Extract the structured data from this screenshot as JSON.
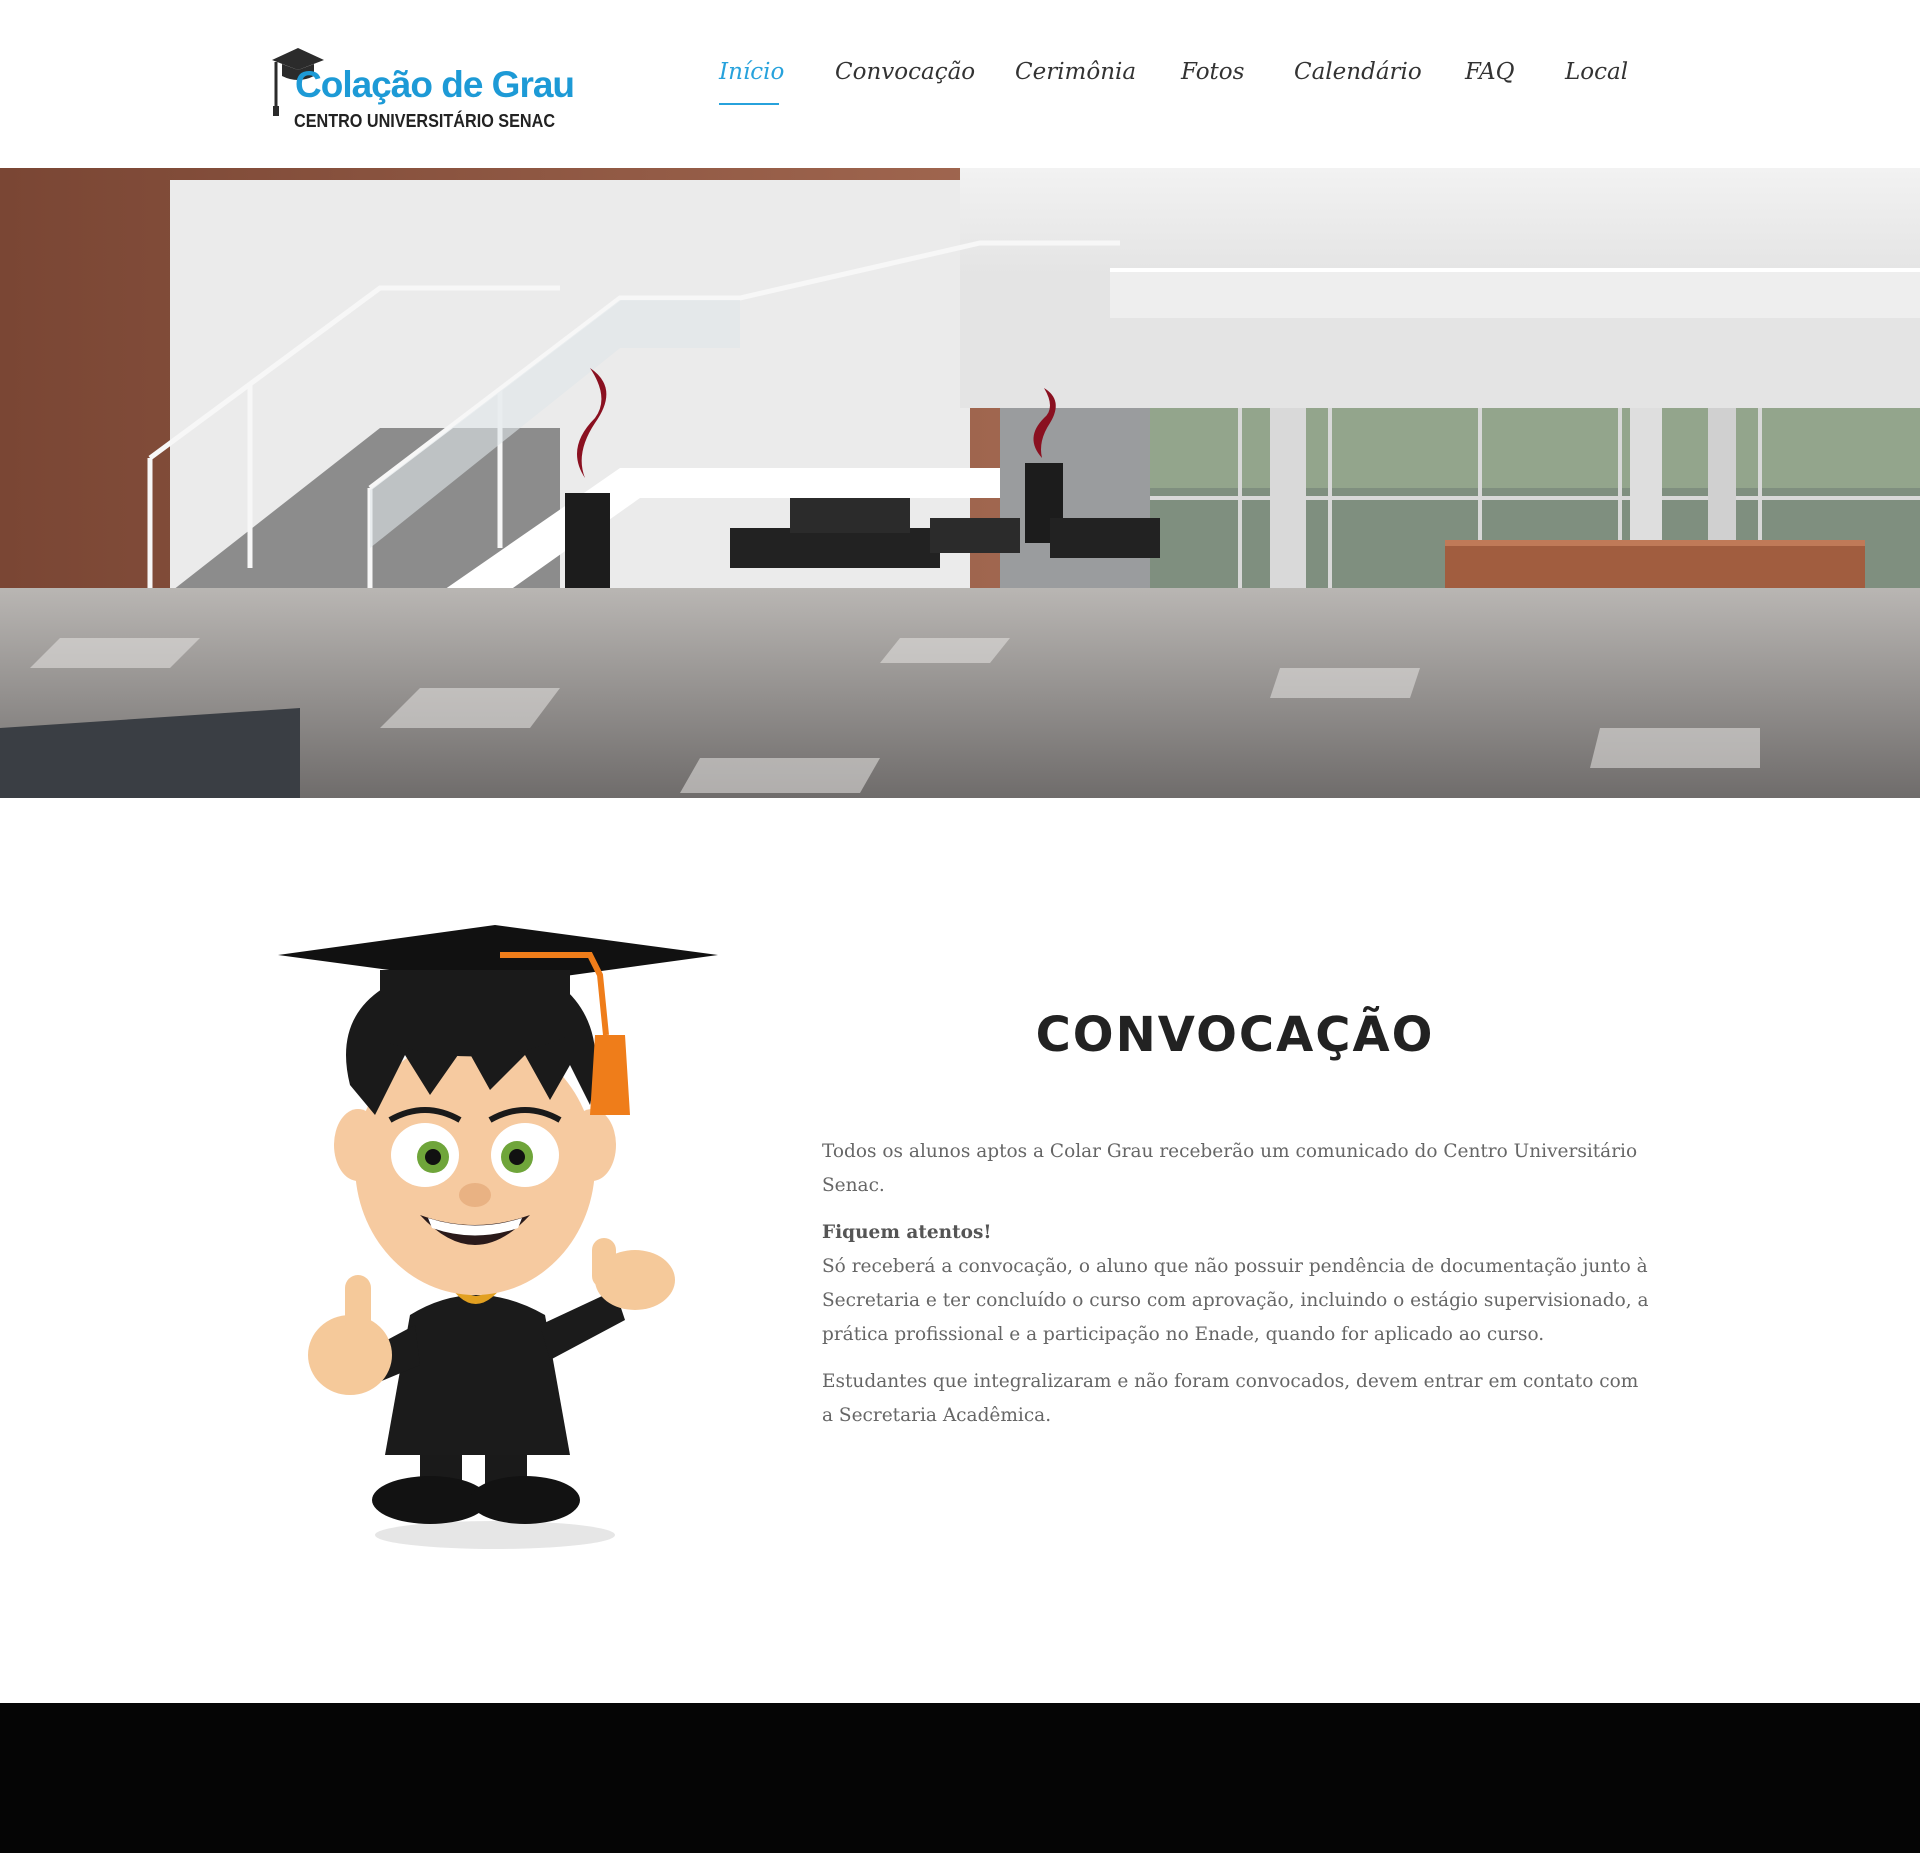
{
  "logo": {
    "title": "Colação de Grau",
    "subtitle": "CENTRO UNIVERSITÁRIO SENAC",
    "icon": "graduation-cap-icon"
  },
  "nav": {
    "items": [
      {
        "label": "Início",
        "active": true
      },
      {
        "label": "Convocação",
        "active": false
      },
      {
        "label": "Cerimônia",
        "active": false
      },
      {
        "label": "Fotos",
        "active": false
      },
      {
        "label": "Calendário",
        "active": false
      },
      {
        "label": "FAQ",
        "active": false
      },
      {
        "label": "Local",
        "active": false
      }
    ]
  },
  "colors": {
    "accent": "#27a2dc",
    "logo_blue": "#1d9ad6",
    "heading": "#222222",
    "body_text": "#666666",
    "footer": "#050505"
  },
  "convocacao": {
    "title": "CONVOCAÇÃO",
    "paragraph1": "Todos os alunos aptos a Colar Grau receberão um comunicado do Centro Universitário Senac.",
    "attention": "Fiquem atentos!",
    "paragraph2": "Só receberá a convocação, o aluno que não possuir pendência de documentação junto à Secretaria e ter concluído o curso com aprovação, incluindo o estágio supervisionado, a prática profissional e a participação no Enade, quando for aplicado ao curso.",
    "paragraph3": "Estudantes que integralizaram e não foram convocados, devem entrar em contato com a Secretaria Acadêmica."
  }
}
